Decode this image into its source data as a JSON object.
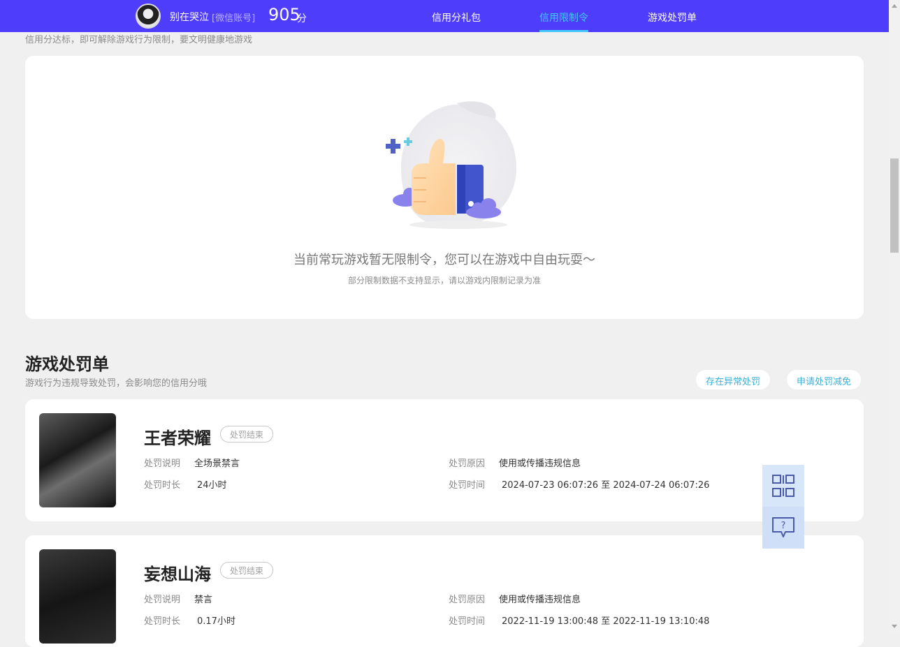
{
  "header": {
    "username": "别在哭泣",
    "account_type": "[微信账号]",
    "score": "905",
    "score_unit": "分",
    "tabs": [
      {
        "label": "信用分礼包",
        "active": false
      },
      {
        "label": "信用限制令",
        "active": true
      },
      {
        "label": "游戏处罚单",
        "active": false
      }
    ]
  },
  "restriction": {
    "description": "信用分达标，即可解除游戏行为限制，要文明健康地游戏",
    "empty_title": "当前常玩游戏暂无限制令，您可以在游戏中自由玩耍～",
    "empty_subtitle": "部分限制数据不支持显示，请以游戏内限制记录为准"
  },
  "penalties": {
    "title": "游戏处罚单",
    "description": "游戏行为违规导致处罚，会影响您的信用分哦",
    "buttons": {
      "abnormal": "存在异常处罚",
      "appeal": "申请处罚减免"
    },
    "labels": {
      "desc": "处罚说明",
      "duration": "处罚时长",
      "reason": "处罚原因",
      "time": "处罚时间"
    },
    "items": [
      {
        "game": "王者荣耀",
        "status": "处罚结束",
        "desc": "全场景禁言",
        "duration": "24小时",
        "reason": "使用或传播违规信息",
        "time": "2024-07-23 06:07:26 至 2024-07-24 06:07:26"
      },
      {
        "game": "妄想山海",
        "status": "处罚结束",
        "desc": "禁言",
        "duration": "0.17小时",
        "reason": "使用或传播违规信息",
        "time": "2022-11-19 13:00:48 至 2022-11-19 13:10:48"
      }
    ]
  },
  "float_panel": {
    "icons": [
      "qr-code-icon",
      "help-chat-icon"
    ]
  },
  "colors": {
    "header_bg": "#4f3dfc",
    "active_tab": "#43c8ff",
    "accent_link": "#3cb0d6",
    "page_bg": "#f0f0f0"
  }
}
